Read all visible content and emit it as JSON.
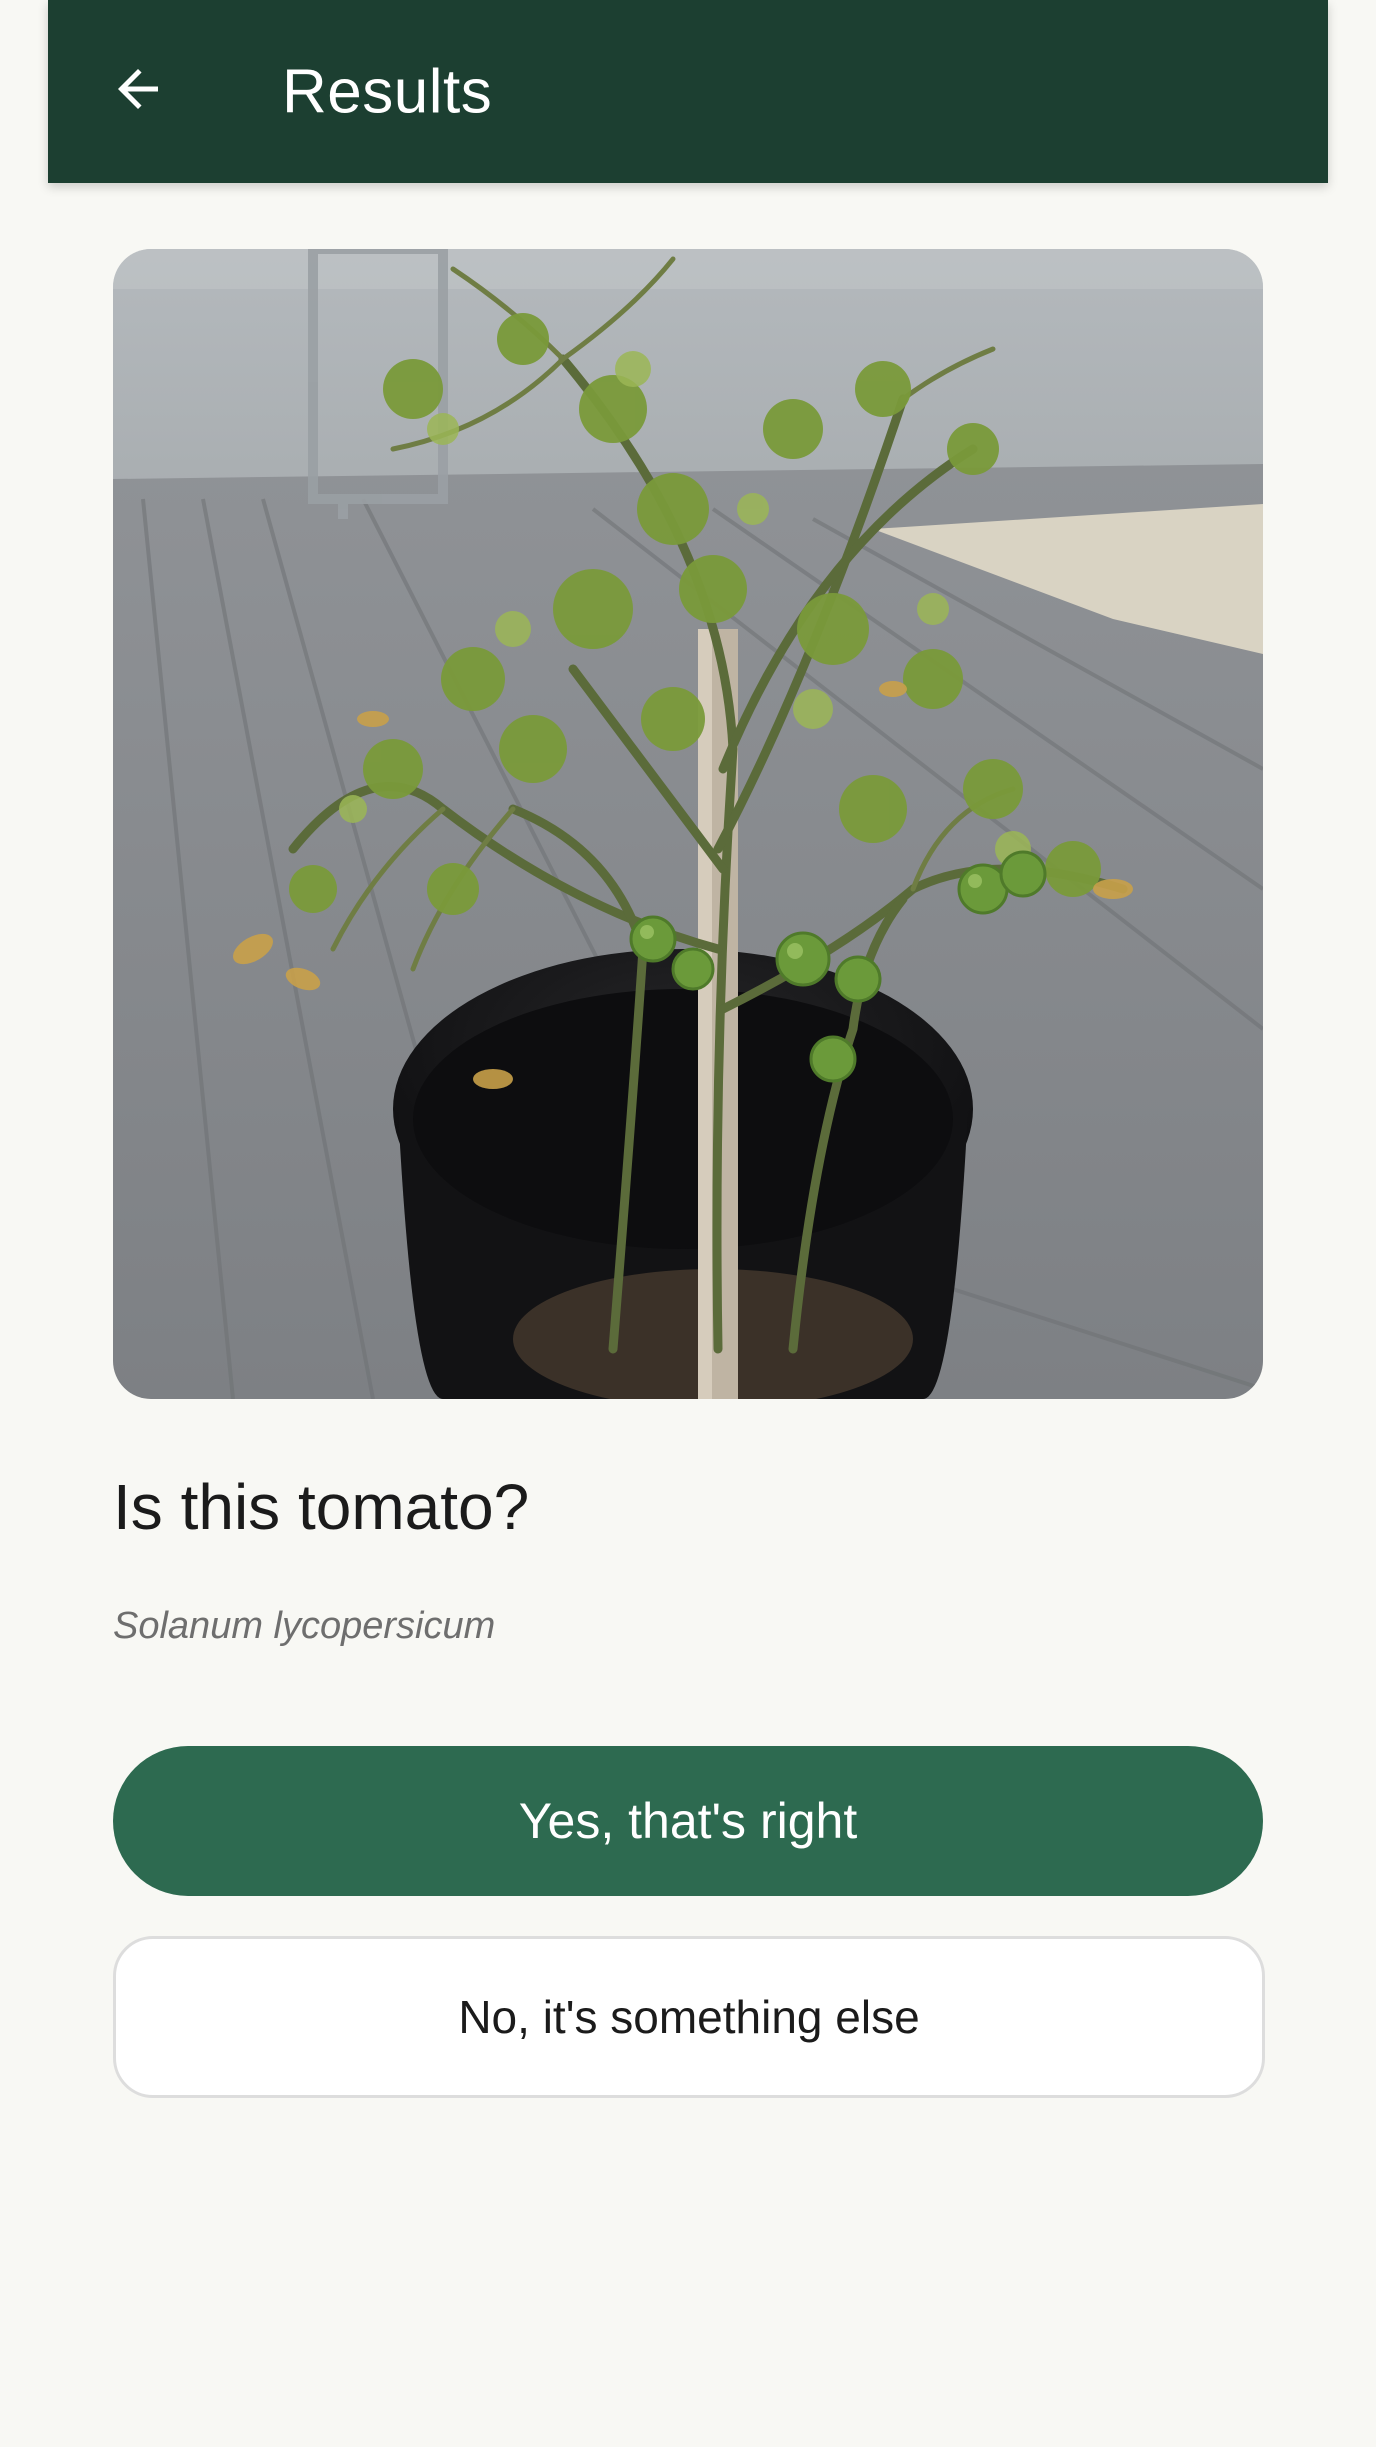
{
  "app_bar": {
    "title": "Results",
    "back_icon": "arrow-left-icon",
    "background": "#1c3f31"
  },
  "result": {
    "question": "Is this tomato?",
    "scientific_name": "Solanum lycopersicum"
  },
  "actions": {
    "confirm_label": "Yes, that's right",
    "reject_label": "No, it's something else",
    "confirm_color": "#2d6a50"
  }
}
